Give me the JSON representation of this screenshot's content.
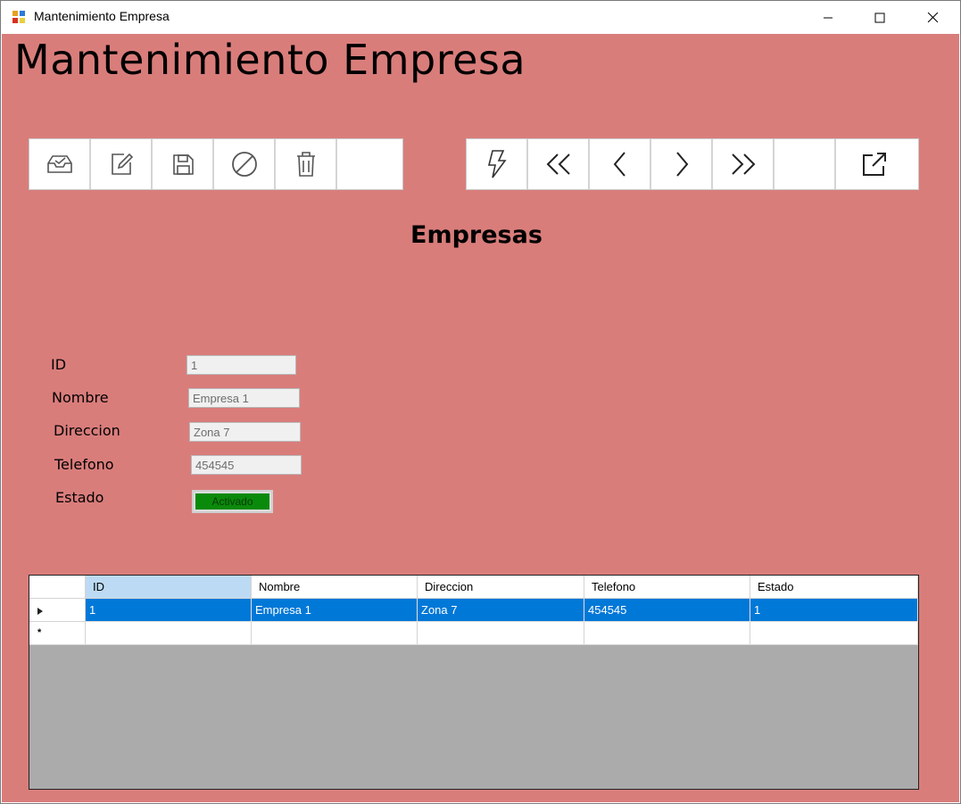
{
  "window": {
    "title": "Mantenimiento Empresa",
    "controls": [
      "minimize-icon",
      "maximize-icon",
      "close-icon"
    ]
  },
  "header": {
    "title": "Mantenimiento Empresa"
  },
  "toolbar_left": {
    "buttons": [
      {
        "icon": "inbox-icon"
      },
      {
        "icon": "edit-icon"
      },
      {
        "icon": "save-icon"
      },
      {
        "icon": "cancel-icon"
      },
      {
        "icon": "trash-icon"
      },
      {
        "icon": ""
      }
    ]
  },
  "toolbar_right": {
    "buttons": [
      {
        "icon": "lightning-icon"
      },
      {
        "icon": "first-icon"
      },
      {
        "icon": "previous-icon"
      },
      {
        "icon": "next-icon"
      },
      {
        "icon": "last-icon"
      },
      {
        "icon": ""
      },
      {
        "icon": "external-link-icon"
      }
    ]
  },
  "section": {
    "title": "Empresas"
  },
  "form": {
    "id_label": "ID",
    "id_value": "1",
    "nombre_label": "Nombre",
    "nombre_value": "Empresa 1",
    "direccion_label": "Direccion",
    "direccion_value": "Zona 7",
    "telefono_label": "Telefono",
    "telefono_value": "454545",
    "estado_label": "Estado",
    "estado_value": "Activado"
  },
  "grid": {
    "columns": [
      "ID",
      "Nombre",
      "Direccion",
      "Telefono",
      "Estado"
    ],
    "rows": [
      [
        "1",
        "Empresa 1",
        "Zona 7",
        "454545",
        "1"
      ]
    ],
    "new_row_marker": "*"
  },
  "colors": {
    "client_bg": "#d97d7b",
    "selection": "#0078d7",
    "estado_active": "#0a8a0a",
    "grid_empty": "#ababab"
  }
}
